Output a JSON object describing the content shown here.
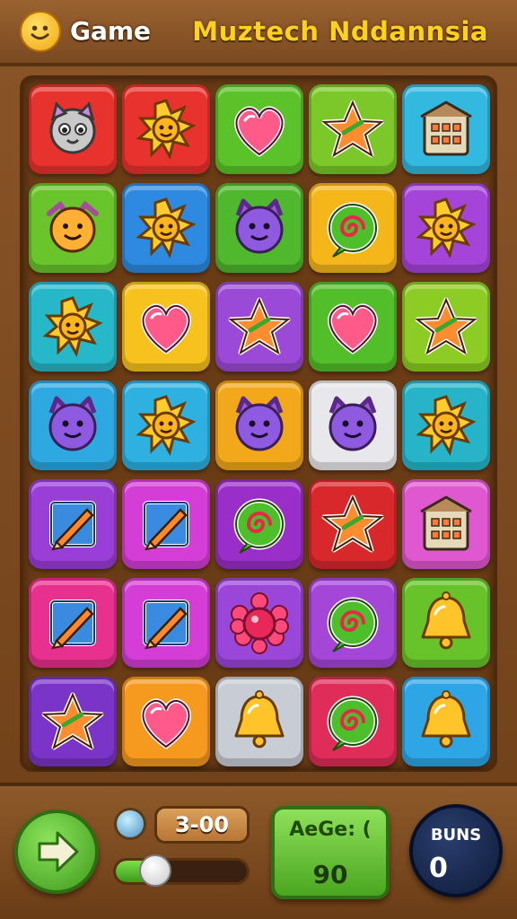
{
  "header": {
    "app_name": "Game",
    "title": "Muztech Nddannsia",
    "smiley_icon": "smiley-face-icon"
  },
  "board": {
    "columns": 5,
    "rows": 7,
    "tiles": [
      [
        {
          "color": "#e8322e",
          "icon": "owl"
        },
        {
          "color": "#e8322e",
          "icon": "sun"
        },
        {
          "color": "#5cc22a",
          "icon": "heart"
        },
        {
          "color": "#7cc82a",
          "icon": "star"
        },
        {
          "color": "#33b8e0",
          "icon": "house"
        }
      ],
      [
        {
          "color": "#6ac42c",
          "icon": "face"
        },
        {
          "color": "#2e8ae0",
          "icon": "sun"
        },
        {
          "color": "#4fb82c",
          "icon": "monster"
        },
        {
          "color": "#f5b61a",
          "icon": "swirl"
        },
        {
          "color": "#a444d8",
          "icon": "sun"
        }
      ],
      [
        {
          "color": "#26b8c8",
          "icon": "sun"
        },
        {
          "color": "#f7c21e",
          "icon": "heart"
        },
        {
          "color": "#9a4ad6",
          "icon": "star"
        },
        {
          "color": "#52be2a",
          "icon": "heart"
        },
        {
          "color": "#8ccc24",
          "icon": "star"
        }
      ],
      [
        {
          "color": "#2ea8e0",
          "icon": "monster"
        },
        {
          "color": "#2eb0e0",
          "icon": "sun"
        },
        {
          "color": "#f2a81a",
          "icon": "monster"
        },
        {
          "color": "#e8e8ec",
          "icon": "monster"
        },
        {
          "color": "#28b4c8",
          "icon": "sun"
        }
      ],
      [
        {
          "color": "#9a3ed8",
          "icon": "pencil"
        },
        {
          "color": "#d43ed6",
          "icon": "pencil"
        },
        {
          "color": "#9a2ec8",
          "icon": "swirl"
        },
        {
          "color": "#d8282c",
          "icon": "star"
        },
        {
          "color": "#e058d0",
          "icon": "house"
        }
      ],
      [
        {
          "color": "#e8308e",
          "icon": "pencil"
        },
        {
          "color": "#d43ed6",
          "icon": "pencil"
        },
        {
          "color": "#9a46d8",
          "icon": "flower"
        },
        {
          "color": "#a446d8",
          "icon": "swirl"
        },
        {
          "color": "#68c22a",
          "icon": "bell"
        }
      ],
      [
        {
          "color": "#7a34c8",
          "icon": "star"
        },
        {
          "color": "#f59a1e",
          "icon": "heart"
        },
        {
          "color": "#c8ccd4",
          "icon": "bell"
        },
        {
          "color": "#e02c58",
          "icon": "swirl"
        },
        {
          "color": "#2ea6e6",
          "icon": "bell"
        }
      ]
    ]
  },
  "bottom_bar": {
    "play_icon": "play-arrow-icon",
    "mini_icon": "balloon-icon",
    "timer": "3-00",
    "progress_fraction": 0.32,
    "score_label": "AeGe: (",
    "score_value": "90",
    "bonus_label": "BUNS",
    "bonus_value": "0"
  }
}
